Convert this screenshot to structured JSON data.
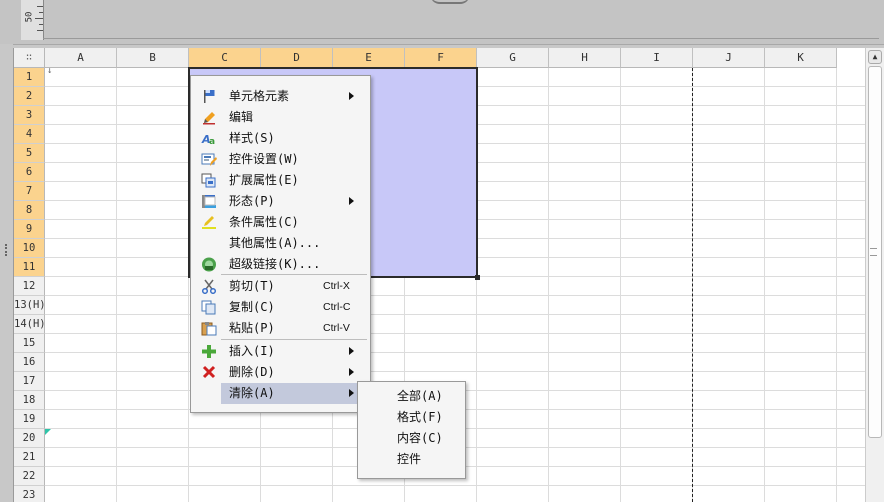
{
  "ruler": {
    "label": "50"
  },
  "columns": [
    "A",
    "B",
    "C",
    "D",
    "E",
    "F",
    "G",
    "H",
    "I",
    "J",
    "K"
  ],
  "rows": [
    "1",
    "2",
    "3",
    "4",
    "5",
    "6",
    "7",
    "8",
    "9",
    "10",
    "11",
    "12",
    "13(H)",
    "14(H)",
    "15",
    "16",
    "17",
    "18",
    "19",
    "20",
    "21",
    "22",
    "23"
  ],
  "selection": {
    "columns": [
      "C",
      "D",
      "E",
      "F"
    ],
    "rows": [
      "1",
      "2",
      "3",
      "4",
      "5",
      "6",
      "7",
      "8",
      "9",
      "10",
      "11"
    ]
  },
  "corner_glyph": "∷",
  "context_menu": {
    "items": [
      {
        "label": "单元格元素",
        "icon": "flag-icon",
        "submenu": true
      },
      {
        "label": "编辑",
        "icon": "pencil-icon"
      },
      {
        "label": "样式(S)",
        "icon": "style-icon"
      },
      {
        "label": "控件设置(W)",
        "icon": "widget-settings-icon"
      },
      {
        "label": "扩展属性(E)",
        "icon": "expand-property-icon"
      },
      {
        "label": "形态(P)",
        "icon": "form-icon",
        "submenu": true
      },
      {
        "label": "条件属性(C)",
        "icon": "condition-pen-icon"
      },
      {
        "label": "其他属性(A)...",
        "icon": ""
      },
      {
        "label": "超级链接(K)...",
        "icon": "hyperlink-icon"
      },
      {
        "label": "剪切(T)",
        "icon": "scissors-icon",
        "shortcut": "Ctrl-X"
      },
      {
        "label": "复制(C)",
        "icon": "copy-icon",
        "shortcut": "Ctrl-C"
      },
      {
        "label": "粘贴(P)",
        "icon": "paste-icon",
        "shortcut": "Ctrl-V"
      },
      {
        "label": "插入(I)",
        "icon": "plus-icon",
        "submenu": true
      },
      {
        "label": "删除(D)",
        "icon": "delete-x-icon",
        "submenu": true
      },
      {
        "label": "清除(A)",
        "icon": "",
        "submenu": true,
        "highlighted": true
      }
    ]
  },
  "clear_submenu": {
    "items": [
      "全部(A)",
      "格式(F)",
      "内容(C)",
      "控件"
    ]
  },
  "colors": {
    "selection_fill": "#c8c8f8",
    "header_selected": "#fbd38e",
    "menu_highlight": "#c3c9dc"
  }
}
